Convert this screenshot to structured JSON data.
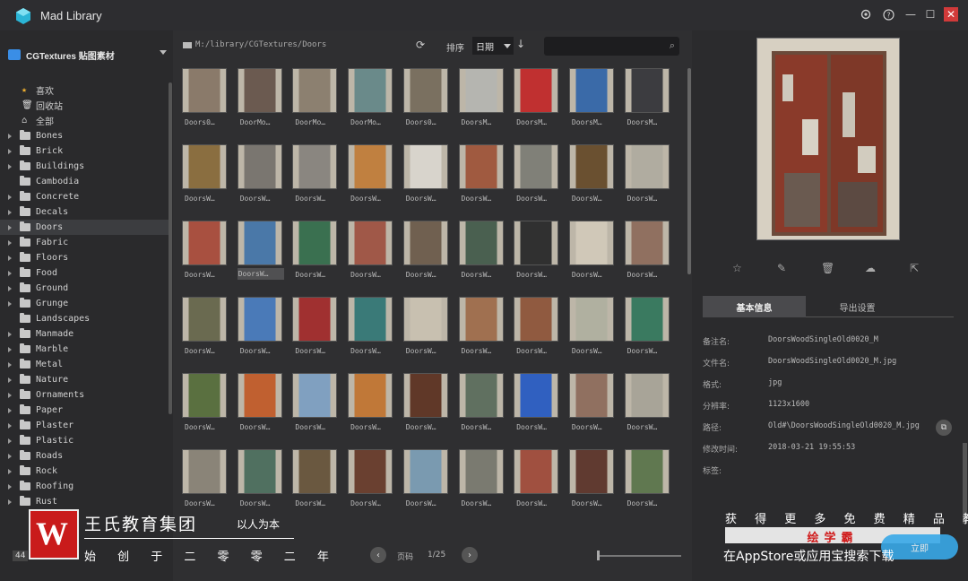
{
  "app": {
    "title": "Mad Library"
  },
  "window": {
    "settings_icon": "gear-icon",
    "help_icon": "?",
    "minimize": "—",
    "maximize": "☐",
    "close": "✕"
  },
  "sidebar": {
    "library_name": "CGTextures 贴图素材",
    "special_items": [
      {
        "label": "喜欢",
        "icon": "★"
      },
      {
        "label": "回收站",
        "icon": "🗑"
      },
      {
        "label": "全部",
        "icon": "⌂"
      }
    ],
    "folders": [
      {
        "label": "Bones",
        "has_children": true
      },
      {
        "label": "Brick",
        "has_children": true
      },
      {
        "label": "Buildings",
        "has_children": true
      },
      {
        "label": "Cambodia",
        "has_children": false
      },
      {
        "label": "Concrete",
        "has_children": true
      },
      {
        "label": "Decals",
        "has_children": true
      },
      {
        "label": "Doors",
        "has_children": true,
        "selected": true
      },
      {
        "label": "Fabric",
        "has_children": true
      },
      {
        "label": "Floors",
        "has_children": true
      },
      {
        "label": "Food",
        "has_children": true
      },
      {
        "label": "Ground",
        "has_children": true
      },
      {
        "label": "Grunge",
        "has_children": true
      },
      {
        "label": "Landscapes",
        "has_children": false
      },
      {
        "label": "Manmade",
        "has_children": true
      },
      {
        "label": "Marble",
        "has_children": true
      },
      {
        "label": "Metal",
        "has_children": true
      },
      {
        "label": "Nature",
        "has_children": true
      },
      {
        "label": "Ornaments",
        "has_children": true
      },
      {
        "label": "Paper",
        "has_children": true
      },
      {
        "label": "Plaster",
        "has_children": true
      },
      {
        "label": "Plastic",
        "has_children": true
      },
      {
        "label": "Roads",
        "has_children": true
      },
      {
        "label": "Rock",
        "has_children": true
      },
      {
        "label": "Roofing",
        "has_children": true
      },
      {
        "label": "Rust",
        "has_children": true
      }
    ],
    "count_badge": "44"
  },
  "toolbar": {
    "path": "M:/library/CGTextures/Doors",
    "sort_label": "排序",
    "sort_value": "日期",
    "sort_direction": "↓",
    "search_placeholder": ""
  },
  "grid": {
    "rows": [
      {
        "labels": [
          "Doors0…",
          "DoorMo…",
          "DoorMo…",
          "DoorMo…",
          "Doors0…",
          "DoorsM…",
          "DoorsM…",
          "DoorsM…",
          "DoorsM…"
        ],
        "colors": [
          "#8a7a6a",
          "#6b5a50",
          "#8c8070",
          "#6a8a8a",
          "#7a7060",
          "#b5b5b0",
          "#c03030",
          "#3a6aa8",
          "#3c3c40"
        ]
      },
      {
        "labels": [
          "DoorsW…",
          "DoorsW…",
          "DoorsW…",
          "DoorsW…",
          "DoorsW…",
          "DoorsW…",
          "DoorsW…",
          "DoorsW…",
          "DoorsW…"
        ],
        "colors": [
          "#8a6e40",
          "#7a7670",
          "#8a8680",
          "#c08040",
          "#d8d4cc",
          "#a05a40",
          "#808078",
          "#6a5030",
          "#b0aca0"
        ]
      },
      {
        "labels": [
          "DoorsW…",
          "DoorsW…",
          "DoorsW…",
          "DoorsW…",
          "DoorsW…",
          "DoorsW…",
          "DoorsW…",
          "DoorsW…",
          "DoorsW…"
        ],
        "colors": [
          "#a85040",
          "#4a78a8",
          "#3a7050",
          "#a05848",
          "#706050",
          "#4a6050",
          "#303030",
          "#d0c8b8",
          "#907060"
        ]
      },
      {
        "labels": [
          "DoorsW…",
          "DoorsW…",
          "DoorsW…",
          "DoorsW…",
          "DoorsW…",
          "DoorsW…",
          "DoorsW…",
          "DoorsW…",
          "DoorsW…"
        ],
        "colors": [
          "#6a6a50",
          "#4a7ab8",
          "#a03030",
          "#3a7a78",
          "#c8c0b0",
          "#a07050",
          "#905a40",
          "#b0b0a0",
          "#3a7a60"
        ]
      },
      {
        "labels": [
          "DoorsW…",
          "DoorsW…",
          "DoorsW…",
          "DoorsW…",
          "DoorsW…",
          "DoorsW…",
          "DoorsW…",
          "DoorsW…",
          "DoorsW…"
        ],
        "colors": [
          "#5a7040",
          "#c06030",
          "#80a0c0",
          "#c07838",
          "#603828",
          "#607060",
          "#3060c0",
          "#907060",
          "#a8a498"
        ]
      },
      {
        "labels": [
          "DoorsW…",
          "DoorsW…",
          "DoorsW…",
          "DoorsW…",
          "DoorsW…",
          "DoorsW…",
          "DoorsW…",
          "DoorsW…",
          "DoorsW…"
        ],
        "colors": [
          "#8a8478",
          "#507060",
          "#6a5840",
          "#6a4030",
          "#7a9ab0",
          "#7a7a70",
          "#a05040",
          "#603a30",
          "#607850"
        ]
      }
    ],
    "selected_index": [
      2,
      1
    ]
  },
  "footer": {
    "prev": "‹",
    "page_label": "页码",
    "page_value": "1/25",
    "next": "›"
  },
  "right": {
    "actions": [
      "star-icon",
      "edit-icon",
      "trash-icon",
      "upload-icon",
      "export-icon"
    ],
    "tabs": {
      "active": "基本信息",
      "inactive": "导出设置"
    },
    "info": [
      {
        "key": "备注名:",
        "value": "DoorsWoodSingleOld0020_M"
      },
      {
        "key": "文件名:",
        "value": "DoorsWoodSingleOld0020_M.jpg"
      },
      {
        "key": "格式:",
        "value": "jpg"
      },
      {
        "key": "分辨率:",
        "value": "1123x1600"
      },
      {
        "key": "路径:",
        "value": "Old#\\DoorsWoodSingleOld0020_M.jpg"
      },
      {
        "key": "修改时间:",
        "value": "2018-03-21 19:55:53"
      },
      {
        "key": "标签:",
        "value": ""
      }
    ]
  },
  "watermark": {
    "logo": "W",
    "company": "王氏教育集团",
    "slogan": "以人为本",
    "since": "始 创 于 二 零 零 二 年",
    "promo1": "获 得 更 多 免 费 精 品 教 程",
    "promo2": "绘学霸",
    "promo3": "在AppStore或应用宝搜索下载",
    "button": "立即"
  }
}
